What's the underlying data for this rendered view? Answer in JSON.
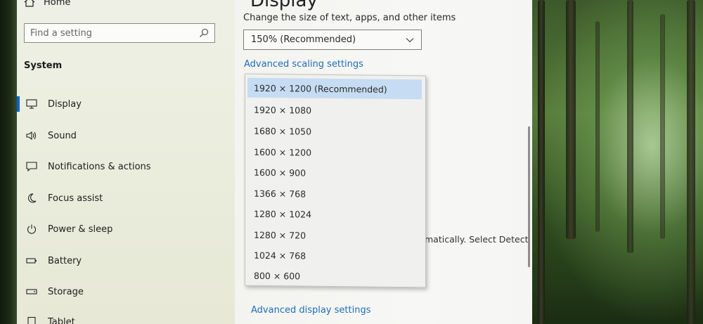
{
  "sidebar": {
    "home_label": "Home",
    "search_placeholder": "Find a setting",
    "section_title": "System",
    "items": [
      {
        "label": "Display",
        "icon": "monitor-icon"
      },
      {
        "label": "Sound",
        "icon": "speaker-icon"
      },
      {
        "label": "Notifications & actions",
        "icon": "message-icon"
      },
      {
        "label": "Focus assist",
        "icon": "moon-icon"
      },
      {
        "label": "Power & sleep",
        "icon": "power-icon"
      },
      {
        "label": "Battery",
        "icon": "battery-icon"
      },
      {
        "label": "Storage",
        "icon": "storage-icon"
      },
      {
        "label": "Tablet",
        "icon": "tablet-icon"
      }
    ]
  },
  "main": {
    "title": "Display",
    "scale_label": "Change the size of text, apps, and other items",
    "scale_value": "150% (Recommended)",
    "advanced_scaling_link": "Advanced scaling settings",
    "partial_text": "matically. Select Detect",
    "advanced_display_link": "Advanced display settings"
  },
  "resolution_dropdown": {
    "options": [
      "1920 × 1200 (Recommended)",
      "1920 × 1080",
      "1680 × 1050",
      "1600 × 1200",
      "1600 × 900",
      "1366 × 768",
      "1280 × 1024",
      "1280 × 720",
      "1024 × 768",
      "800 × 600"
    ],
    "selected_index": 0
  },
  "colors": {
    "accent": "#0a66c8",
    "link": "#1f6fb8",
    "selected_bg": "#c6dcf2"
  }
}
